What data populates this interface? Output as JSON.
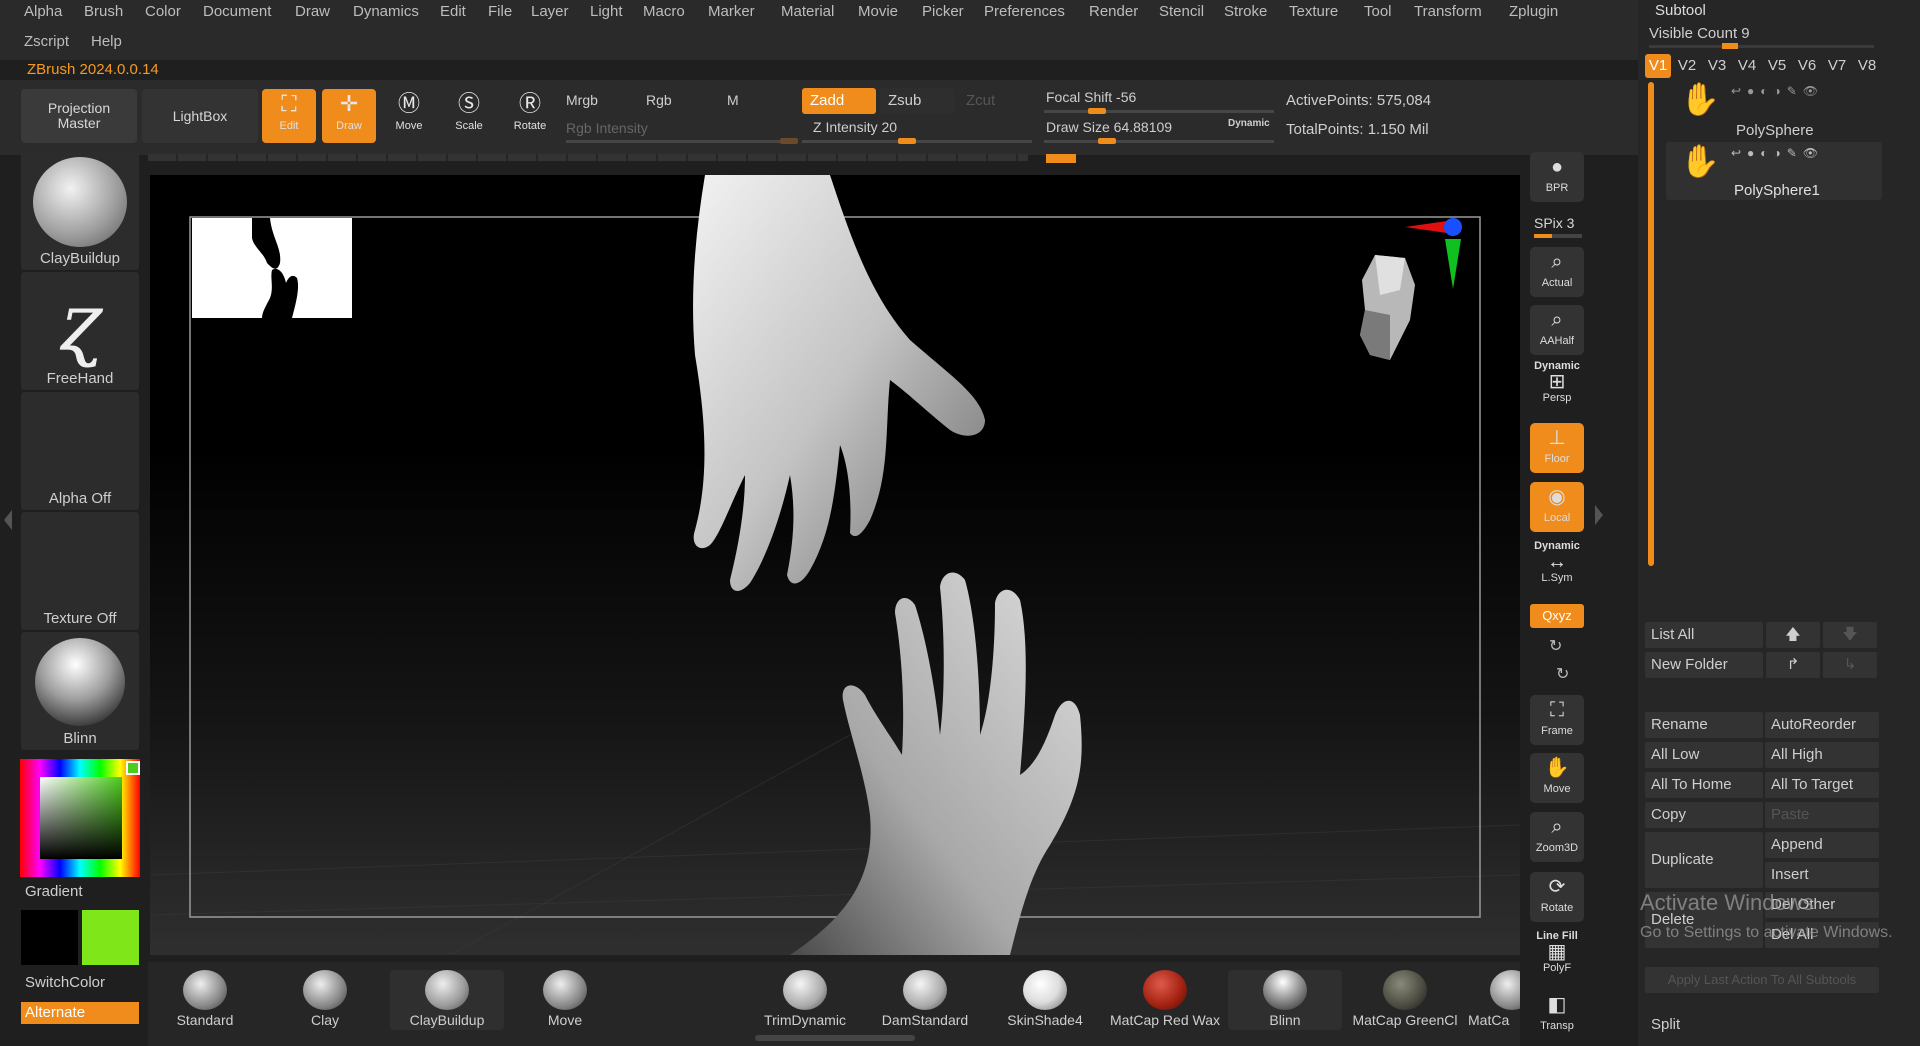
{
  "menu": {
    "row1": [
      "Alpha",
      "Brush",
      "Color",
      "Document",
      "Draw",
      "Dynamics",
      "Edit",
      "File",
      "Layer",
      "Light",
      "Macro",
      "Marker",
      "Material",
      "Movie",
      "Picker",
      "Preferences",
      "Render",
      "Stencil",
      "Stroke",
      "Texture",
      "Tool",
      "Transform",
      "Zplugin"
    ],
    "row2": [
      "Zscript",
      "Help"
    ]
  },
  "version": "ZBrush 2024.0.0.14",
  "shelf": {
    "projection_master": "Projection\nMaster",
    "lightbox": "LightBox",
    "edit": "Edit",
    "draw": "Draw",
    "move": "Move",
    "scale": "Scale",
    "rotate": "Rotate",
    "mrgb": "Mrgb",
    "rgb": "Rgb",
    "m": "M",
    "rgb_intensity": "Rgb Intensity",
    "zadd": "Zadd",
    "zsub": "Zsub",
    "zcut": "Zcut",
    "z_intensity": "Z Intensity 20",
    "focal_shift": "Focal Shift -56",
    "draw_size": "Draw Size 64.88109",
    "dynamic": "Dynamic",
    "active_points": "ActivePoints: 575,084",
    "total_points": "TotalPoints: 1.150 Mil"
  },
  "left": {
    "brush": "ClayBuildup",
    "stroke": "FreeHand",
    "alpha": "Alpha Off",
    "texture": "Texture Off",
    "material": "Blinn",
    "gradient": "Gradient",
    "switch_color": "SwitchColor",
    "alternate": "Alternate"
  },
  "right_toolbar": {
    "bpr": "BPR",
    "spix": "SPix 3",
    "actual": "Actual",
    "aahalf": "AAHalf",
    "dynamic_persp": "Dynamic",
    "persp": "Persp",
    "floor": "Floor",
    "local": "Local",
    "dynamic_lsym": "Dynamic",
    "lsym": "L.Sym",
    "xyz": "Qxyz",
    "frame": "Frame",
    "move": "Move",
    "zoom3d": "Zoom3D",
    "rotate": "Rotate",
    "line_fill": "Line Fill",
    "polyf": "PolyF",
    "transp": "Transp"
  },
  "subtool": {
    "title": "Subtool",
    "visible_count": "Visible Count 9",
    "tabs": [
      "V1",
      "V2",
      "V3",
      "V4",
      "V5",
      "V6",
      "V7",
      "V8"
    ],
    "items": [
      {
        "name": "PolySphere"
      },
      {
        "name": "PolySphere1"
      }
    ],
    "buttons": {
      "list_all": "List All",
      "new_folder": "New Folder",
      "rename": "Rename",
      "auto_reorder": "AutoReorder",
      "all_low": "All Low",
      "all_high": "All High",
      "all_to_home": "All To Home",
      "all_to_target": "All To Target",
      "copy": "Copy",
      "paste": "Paste",
      "duplicate": "Duplicate",
      "append": "Append",
      "insert": "Insert",
      "delete": "Delete",
      "del_other": "Del Other",
      "del_all": "Del All",
      "apply_last": "Apply Last Action To All Subtools",
      "split": "Split"
    }
  },
  "bottom_brushes": [
    "Standard",
    "Clay",
    "ClayBuildup",
    "Move",
    "TrimDynamic",
    "DamStandard",
    "SkinShade4",
    "MatCap Red Wax",
    "Blinn",
    "MatCap GreenCl",
    "MatCa"
  ],
  "watermark": {
    "line1": "Activate Windows",
    "line2": "Go to Settings to activate Windows."
  },
  "colors": {
    "accent": "#f08c1c",
    "primary_color": "#000000",
    "secondary_color": "#7fe61a"
  }
}
